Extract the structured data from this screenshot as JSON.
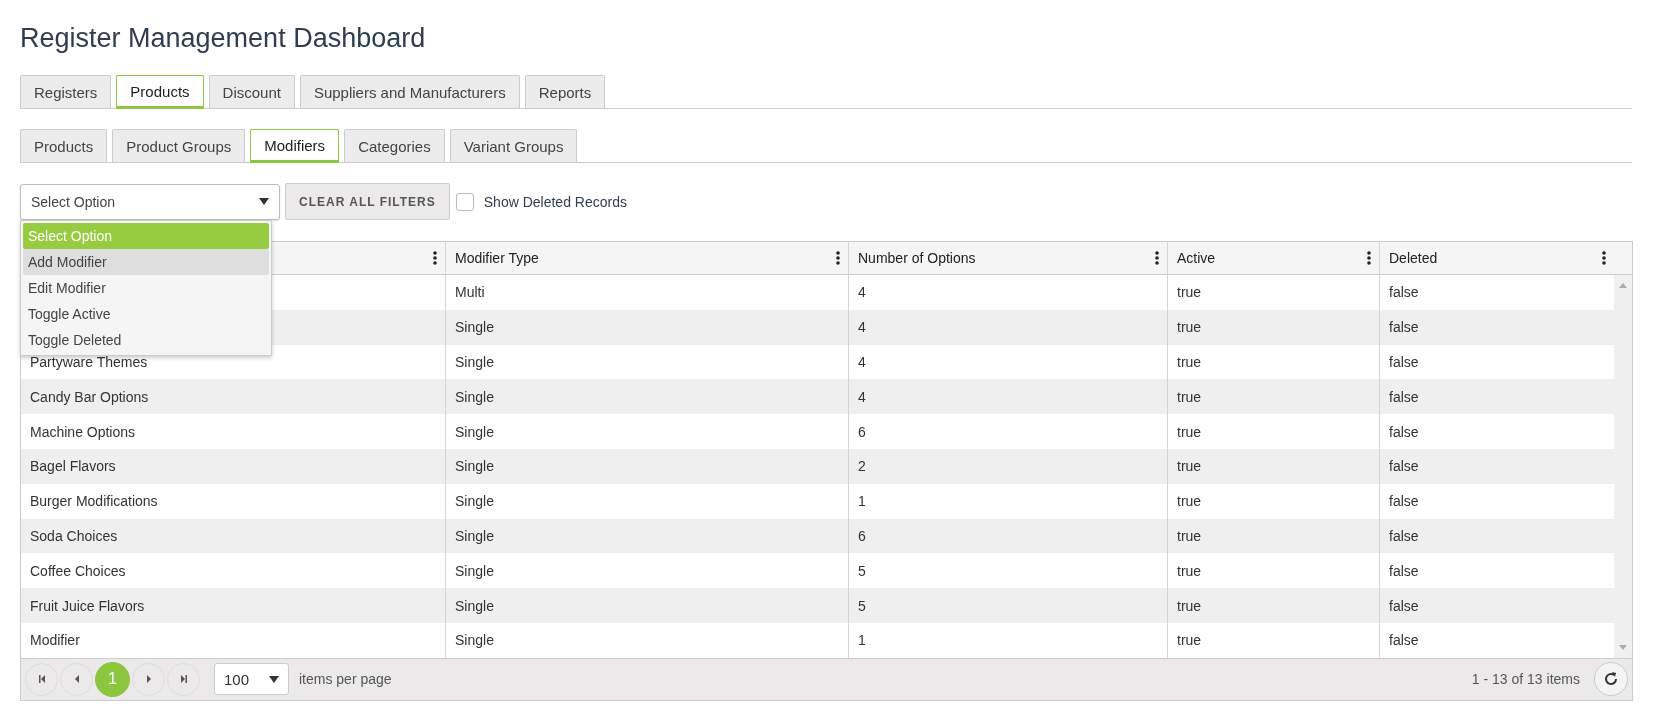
{
  "title": "Register Management Dashboard",
  "main_tabs": [
    {
      "label": "Registers",
      "selected": false
    },
    {
      "label": "Products",
      "selected": true
    },
    {
      "label": "Discount",
      "selected": false
    },
    {
      "label": "Suppliers and Manufacturers",
      "selected": false
    },
    {
      "label": "Reports",
      "selected": false
    }
  ],
  "sub_tabs": [
    {
      "label": "Products",
      "selected": false
    },
    {
      "label": "Product Groups",
      "selected": false
    },
    {
      "label": "Modifiers",
      "selected": true
    },
    {
      "label": "Categories",
      "selected": false
    },
    {
      "label": "Variant Groups",
      "selected": false
    }
  ],
  "action_select": {
    "value": "Select Option",
    "expanded": true,
    "options": [
      {
        "label": "Select Option",
        "selected": true,
        "hovered": false
      },
      {
        "label": "Add Modifier",
        "selected": false,
        "hovered": true
      },
      {
        "label": "Edit Modifier",
        "selected": false,
        "hovered": false
      },
      {
        "label": "Toggle Active",
        "selected": false,
        "hovered": false
      },
      {
        "label": "Toggle Deleted",
        "selected": false,
        "hovered": false
      }
    ]
  },
  "clear_button": "CLEAR ALL FILTERS",
  "show_deleted": {
    "label": "Show Deleted Records",
    "checked": false
  },
  "table": {
    "columns": [
      {},
      {
        "label": "Modifier Type"
      },
      {
        "label": "Number of Options"
      },
      {
        "label": "Active"
      },
      {
        "label": "Deleted"
      }
    ],
    "rows": [
      [
        null,
        "Multi",
        "4",
        "true",
        "false"
      ],
      [
        null,
        "Single",
        "4",
        "true",
        "false"
      ],
      [
        "Partyware Themes",
        "Single",
        "4",
        "true",
        "false"
      ],
      [
        "Candy Bar Options",
        "Single",
        "4",
        "true",
        "false"
      ],
      [
        "Machine Options",
        "Single",
        "6",
        "true",
        "false"
      ],
      [
        "Bagel Flavors",
        "Single",
        "2",
        "true",
        "false"
      ],
      [
        "Burger Modifications",
        "Single",
        "1",
        "true",
        "false"
      ],
      [
        "Soda Choices",
        "Single",
        "6",
        "true",
        "false"
      ],
      [
        "Coffee Choices",
        "Single",
        "5",
        "true",
        "false"
      ],
      [
        "Fruit Juice Flavors",
        "Single",
        "5",
        "true",
        "false"
      ],
      [
        "Modifier",
        "Single",
        "1",
        "true",
        "false"
      ]
    ]
  },
  "pager": {
    "pages": [
      {
        "label": "1",
        "selected": true
      }
    ],
    "page_size": "100",
    "page_size_label": "items per page",
    "summary": "1 - 13 of 13 items"
  }
}
